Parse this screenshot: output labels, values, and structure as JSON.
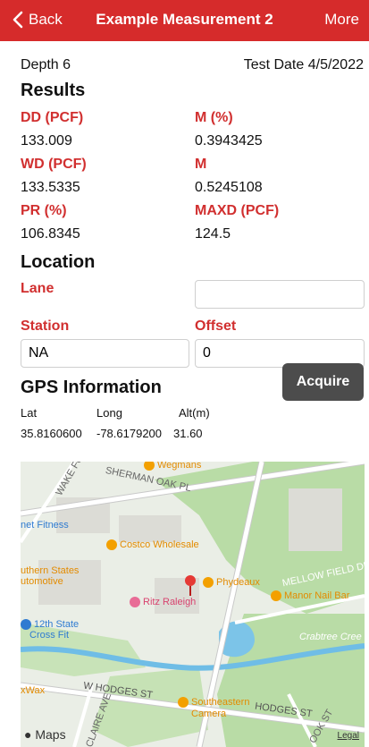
{
  "nav": {
    "back_label": "Back",
    "title": "Example Measurement 2",
    "more_label": "More"
  },
  "header": {
    "depth": "Depth 6",
    "test_date": "Test Date 4/5/2022"
  },
  "results": {
    "title": "Results",
    "dd_label": "DD (PCF)",
    "dd_value": "133.009",
    "m_pct_label": "M (%)",
    "m_pct_value": "0.3943425",
    "wd_label": "WD (PCF)",
    "wd_value": "133.5335",
    "m_label": "M",
    "m_value": "0.5245108",
    "pr_label": "PR (%)",
    "pr_value": "106.8345",
    "maxd_label": "MAXD (PCF)",
    "maxd_value": "124.5"
  },
  "location": {
    "title": "Location",
    "lane_label": "Lane",
    "lane_value": "",
    "station_label": "Station",
    "station_value": "NA",
    "offset_label": "Offset",
    "offset_value": "0"
  },
  "gps": {
    "title": "GPS Information",
    "lat_label": "Lat",
    "long_label": "Long",
    "alt_label": "Alt(m)",
    "lat_value": "35.8160600",
    "long_value": "-78.6179200",
    "alt_value": "31.60",
    "acquire_label": "Acquire"
  },
  "map": {
    "poi_wegmans": "Wegmans",
    "poi_fitness": "net Fitness",
    "poi_costco": "Costco Wholesale",
    "poi_southern": "uthern States",
    "poi_automotive": "utomotive",
    "poi_ritz": "Ritz Raleigh",
    "poi_phydeaux": "Phydeaux",
    "poi_manor": "Manor Nail Bar",
    "poi_12th": "12th State",
    "poi_crossfit": "Cross Fit",
    "poi_xwax": "xWax",
    "poi_southeastern": "Southeastern",
    "poi_camera": "Camera",
    "street_wake": "WAKE FOR",
    "street_sherman": "SHERMAN OAK PL",
    "street_mellow": "MELLOW FIELD DR",
    "street_hodges1": "W HODGES ST",
    "street_hodges2": "HODGES ST",
    "street_claire": "CLAIRE AVE",
    "street_oak": "OOK ST",
    "creek": "Crabtree Cree",
    "maps_logo": "Maps",
    "legal": "Legal"
  },
  "colors": {
    "accent": "#d62b2b",
    "label_red": "#d12f2f",
    "button_dark": "#4c4c4c"
  }
}
